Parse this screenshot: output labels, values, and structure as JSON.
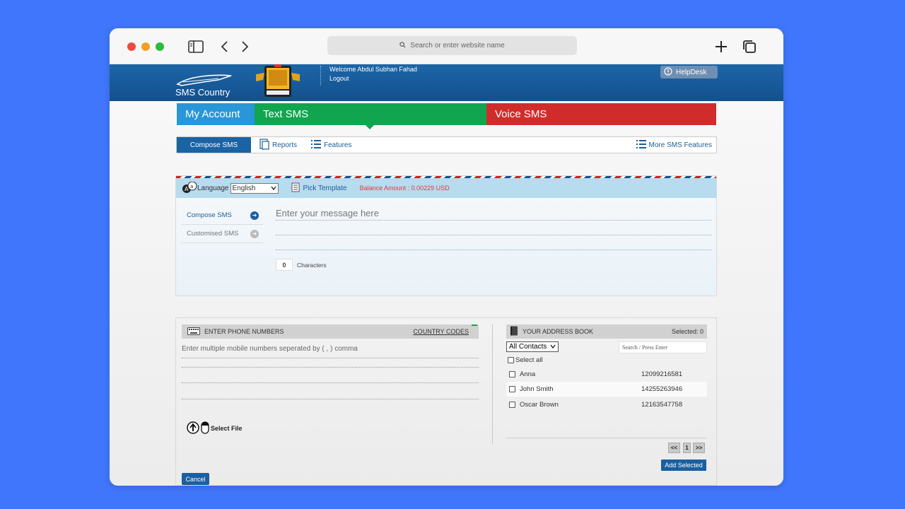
{
  "browser": {
    "url_placeholder": "Search or enter website name"
  },
  "header": {
    "logo_text": "SMS Country",
    "welcome": "Welcome Abdul Subhan Fahad",
    "logout": "Logout",
    "helpdesk": "HelpDesk"
  },
  "main_tabs": {
    "my_account": "My Account",
    "text_sms": "Text SMS",
    "voice_sms": "Voice SMS"
  },
  "sub_nav": {
    "compose": "Compose SMS",
    "reports": "Reports",
    "features": "Features",
    "more": "More SMS Features"
  },
  "compose": {
    "language_label": "Language",
    "language_value": "English",
    "pick_template": "Pick Template",
    "balance": "Balance Amount : 0.00229 USD",
    "side_compose": "Compose SMS",
    "side_customised": "Customised SMS",
    "message_placeholder": "Enter your message here",
    "char_count": "0",
    "char_label": "Characters"
  },
  "phone": {
    "header": "ENTER PHONE NUMBERS",
    "country_codes": "COUNTRY CODES",
    "placeholder": "Enter multiple mobile numbers seperated by ( , ) comma",
    "select_file": "Select File"
  },
  "address_book": {
    "header": "YOUR ADDRESS BOOK",
    "selected": "Selected: 0",
    "filter_value": "All Contacts",
    "search_placeholder": "Search / Press Enter",
    "select_all": "Select all",
    "contacts": [
      {
        "name": "Anna",
        "number": "12099216581"
      },
      {
        "name": "John Smith",
        "number": "14255263946"
      },
      {
        "name": "Oscar Brown",
        "number": "12163547758"
      }
    ],
    "pager_prev": "<<",
    "pager_page": "1",
    "pager_next": ">>",
    "add_selected": "Add Selected"
  },
  "cancel": "Cancel",
  "colors": {
    "page_bg": "#4076fb",
    "header_blue": "#1d66a8",
    "my_account": "#2996d8",
    "text_sms": "#12a550",
    "voice_sms": "#d12c2c",
    "balance": "#e03a3a"
  }
}
